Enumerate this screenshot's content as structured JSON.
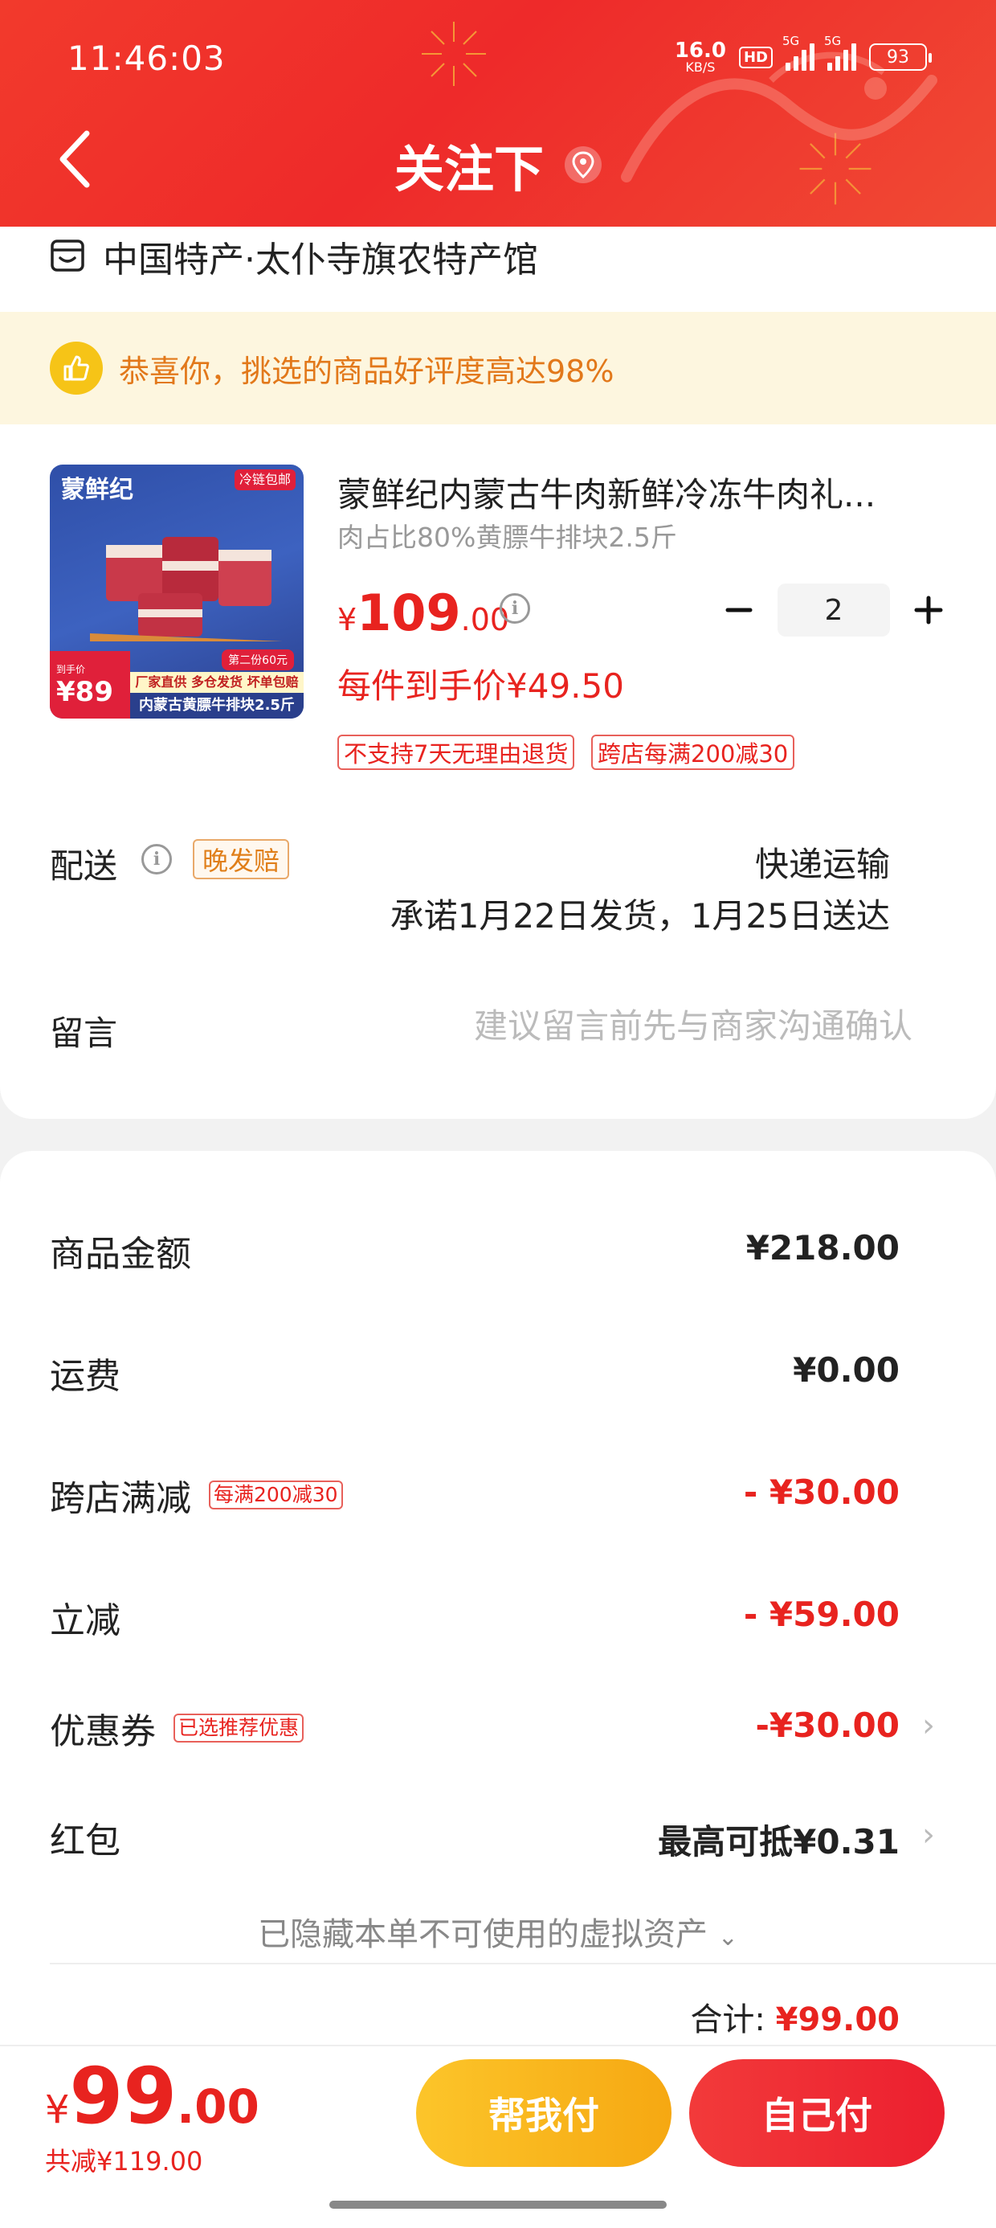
{
  "status_bar": {
    "time": "11:46:03",
    "net_speed_value": "16.0",
    "net_speed_unit": "KB/S",
    "hd_label": "HD",
    "signal1_label": "5G",
    "signal2_label": "5G",
    "battery": "93"
  },
  "header": {
    "title": "关注下",
    "icons": {
      "back": "chevron-left-icon",
      "location": "location-pin-icon"
    },
    "background_color": "#ee2a2a"
  },
  "store": {
    "name": "中国特产·太仆寺旗农特产馆",
    "icon": "store-icon"
  },
  "rating_banner": {
    "text": "恭喜你，挑选的商品好评度高达98%",
    "icon": "thumbs-up-icon"
  },
  "product": {
    "title": "蒙鲜纪内蒙古牛肉新鲜冷冻牛肉礼...",
    "spec": "肉占比80%黄膘牛排块2.5斤",
    "price_currency": "¥",
    "price_integer": "109",
    "price_decimal": ".00",
    "unit_price_text": "每件到手价¥49.50",
    "quantity": "2",
    "tags": [
      "不支持7天无理由退货",
      "跨店每满200减30"
    ],
    "image": {
      "brand": "蒙鲜纪",
      "corner_tag": "冷链包邮",
      "price_small": "到手价",
      "price_big": "¥89",
      "second_piece": "第二份60元",
      "strip1": "厂家直供 多仓发货 坏单包赔",
      "strip2": "内蒙古黄膘牛排块2.5斤"
    }
  },
  "delivery": {
    "label": "配送",
    "late_tag": "晚发赔",
    "method": "快递运输",
    "promise": "承诺1月22日发货，1月25日送达"
  },
  "message": {
    "label": "留言",
    "placeholder": "建议留言前先与商家沟通确认"
  },
  "summary": {
    "goods_label": "商品金额",
    "goods_value": "¥218.00",
    "shipping_label": "运费",
    "shipping_value": "¥0.00",
    "cross_store_label": "跨店满减",
    "cross_store_tag": "每满200减30",
    "cross_store_value": "- ¥30.00",
    "instant_label": "立减",
    "instant_value": "- ¥59.00",
    "coupon_label": "优惠券",
    "coupon_tag": "已选推荐优惠",
    "coupon_value": "-¥30.00",
    "redpacket_label": "红包",
    "redpacket_value": "最高可抵¥0.31",
    "hidden_assets": "已隐藏本单不可使用的虚拟资产",
    "total_label": "合计:",
    "total_value": "¥99.00"
  },
  "bottom_bar": {
    "price_currency": "¥",
    "price_integer": "99",
    "price_decimal": ".00",
    "saved_text": "共减¥119.00",
    "help_pay_label": "帮我付",
    "self_pay_label": "自己付"
  },
  "colors": {
    "accent_red": "#e8231f",
    "header_red": "#ee2a2a",
    "help_pay_yellow": "#f6b51e",
    "banner_bg": "#fdf6df",
    "banner_text": "#e2781a"
  }
}
